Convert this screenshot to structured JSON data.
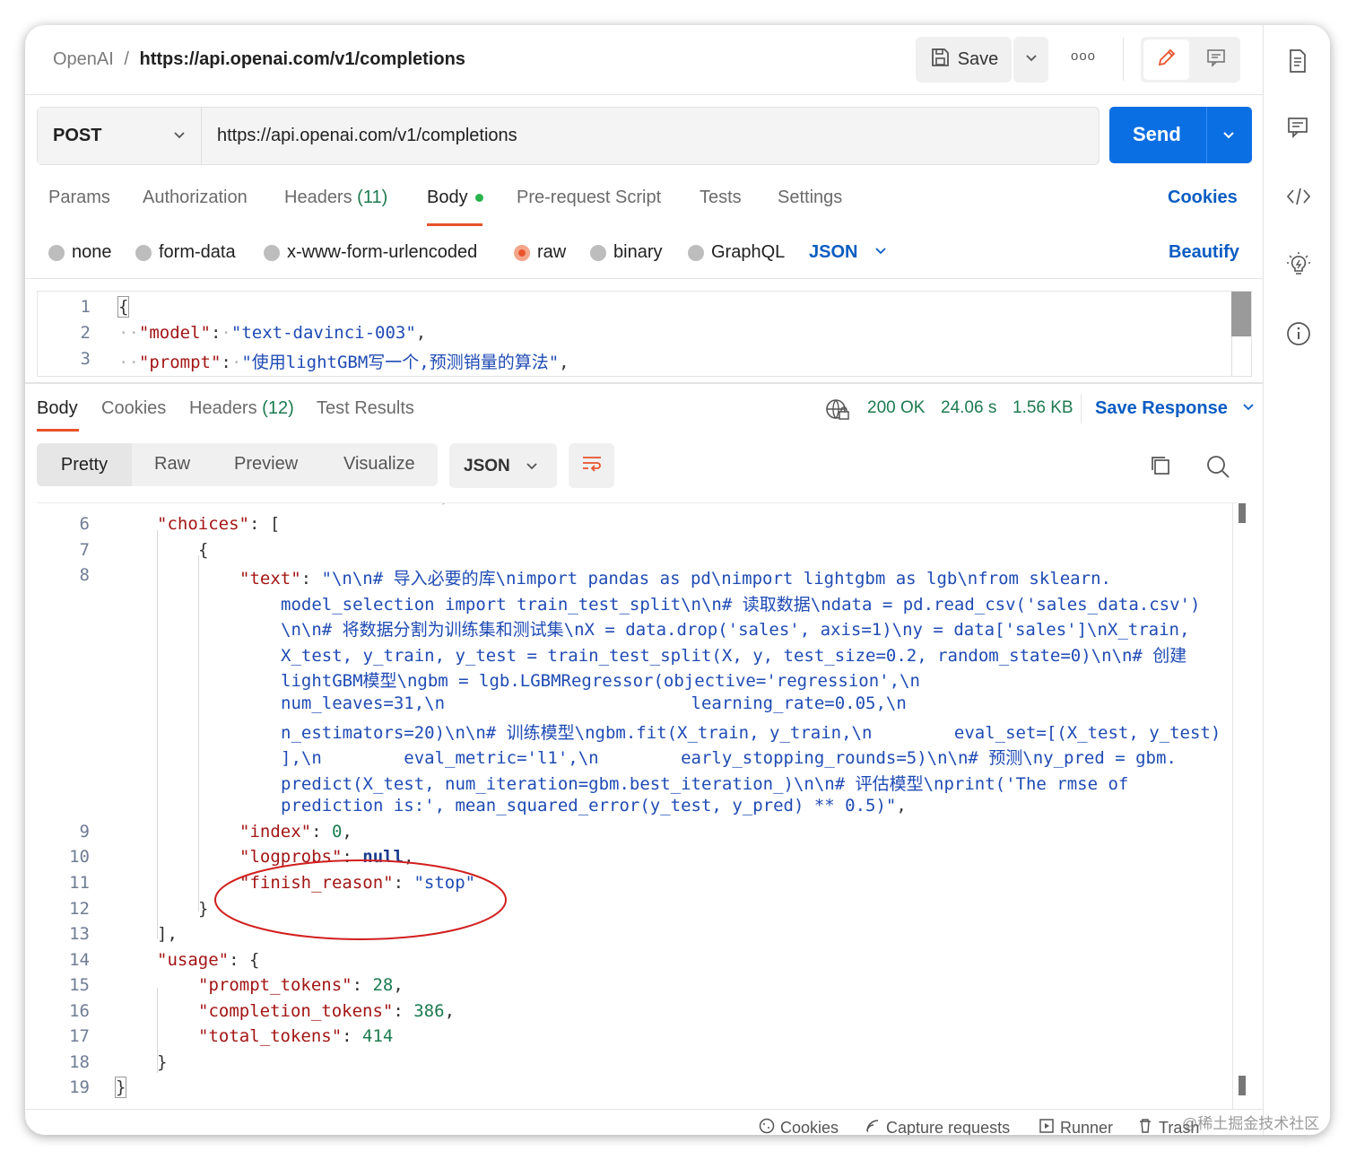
{
  "header": {
    "workspace": "OpenAI",
    "separator": "/",
    "request_name": "https://api.openai.com/v1/completions",
    "save_label": "Save",
    "more_label": "ooo"
  },
  "request": {
    "method": "POST",
    "url": "https://api.openai.com/v1/completions",
    "send_label": "Send"
  },
  "request_tabs": {
    "params": "Params",
    "authorization": "Authorization",
    "headers": "Headers",
    "headers_count": "(11)",
    "body": "Body",
    "pre_request": "Pre-request Script",
    "tests": "Tests",
    "settings": "Settings",
    "cookies": "Cookies"
  },
  "body_types": {
    "none": "none",
    "form_data": "form-data",
    "urlencoded": "x-www-form-urlencoded",
    "raw": "raw",
    "binary": "binary",
    "graphql": "GraphQL",
    "format": "JSON",
    "beautify": "Beautify",
    "selected": "raw"
  },
  "request_body": {
    "line_numbers": [
      "1",
      "2",
      "3"
    ],
    "line1": "{",
    "line2_key": "\"model\"",
    "line2_value": "\"text-davinci-003\"",
    "line3_key": "\"prompt\"",
    "line3_value": "\"使用lightGBM写一个,预测销量的算法\""
  },
  "response_tabs": {
    "body": "Body",
    "cookies": "Cookies",
    "headers": "Headers",
    "headers_count": "(12)",
    "test_results": "Test Results",
    "status": "200 OK",
    "time": "24.06 s",
    "size": "1.56 KB",
    "save_response": "Save Response"
  },
  "view_modes": {
    "pretty": "Pretty",
    "raw": "Raw",
    "preview": "Preview",
    "visualize": "Visualize",
    "format": "JSON"
  },
  "response_body": {
    "line_numbers": [
      "6",
      "7",
      "8",
      "9",
      "10",
      "11",
      "12",
      "13",
      "14",
      "15",
      "16",
      "17",
      "18",
      "19"
    ],
    "choices_key": "\"choices\"",
    "text_key": "\"text\"",
    "text_lines": [
      "\"\\n\\n# 导入必要的库\\nimport pandas as pd\\nimport lightgbm as lgb\\nfrom sklearn.",
      "model_selection import train_test_split\\n\\n# 读取数据\\ndata = pd.read_csv('sales_data.csv')",
      "\\n\\n# 将数据分割为训练集和测试集\\nX = data.drop('sales', axis=1)\\ny = data['sales']\\nX_train,",
      "X_test, y_train, y_test = train_test_split(X, y, test_size=0.2, random_state=0)\\n\\n# 创建",
      "lightGBM模型\\ngbm = lgb.LGBMRegressor(objective='regression',\\n",
      "num_leaves=31,\\n                        learning_rate=0.05,\\n",
      "n_estimators=20)\\n\\n# 训练模型\\ngbm.fit(X_train, y_train,\\n        eval_set=[(X_test, y_test)",
      "],\\n        eval_metric='l1',\\n        early_stopping_rounds=5)\\n\\n# 预测\\ny_pred = gbm.",
      "predict(X_test, num_iteration=gbm.best_iteration_)\\n\\n# 评估模型\\nprint('The rmse of",
      "prediction is:', mean_squared_error(y_test, y_pred) ** 0.5)\""
    ],
    "index_key": "\"index\"",
    "index_value": "0",
    "logprobs_key": "\"logprobs\"",
    "logprobs_value": "null",
    "finish_key": "\"finish_reason\"",
    "finish_value": "\"stop\"",
    "usage_key": "\"usage\"",
    "prompt_tokens_key": "\"prompt_tokens\"",
    "prompt_tokens_value": "28",
    "completion_tokens_key": "\"completion_tokens\"",
    "completion_tokens_value": "386",
    "total_tokens_key": "\"total_tokens\"",
    "total_tokens_value": "414"
  },
  "footer": {
    "cookies": "Cookies",
    "capture": "Capture requests",
    "runner": "Runner",
    "trash": "Trash",
    "watermark": "@稀土掘金技术社区"
  },
  "colors": {
    "accent_blue": "#0b6fe4",
    "link_blue": "#0a5cc2",
    "status_green": "#1c7b4f",
    "body_dot": "#2bb24c",
    "radio_selected": "#e8532b",
    "annotation_red": "#d21f1f"
  },
  "icons": {
    "save": "save-icon",
    "edit": "pencil-icon",
    "comment": "comment-icon",
    "document": "document-icon",
    "code": "code-icon",
    "bulb": "lightbulb-icon",
    "info": "info-icon",
    "globe": "globe-lock-icon",
    "wrap": "wrap-lines-icon",
    "copy": "copy-icon",
    "search": "search-icon"
  }
}
